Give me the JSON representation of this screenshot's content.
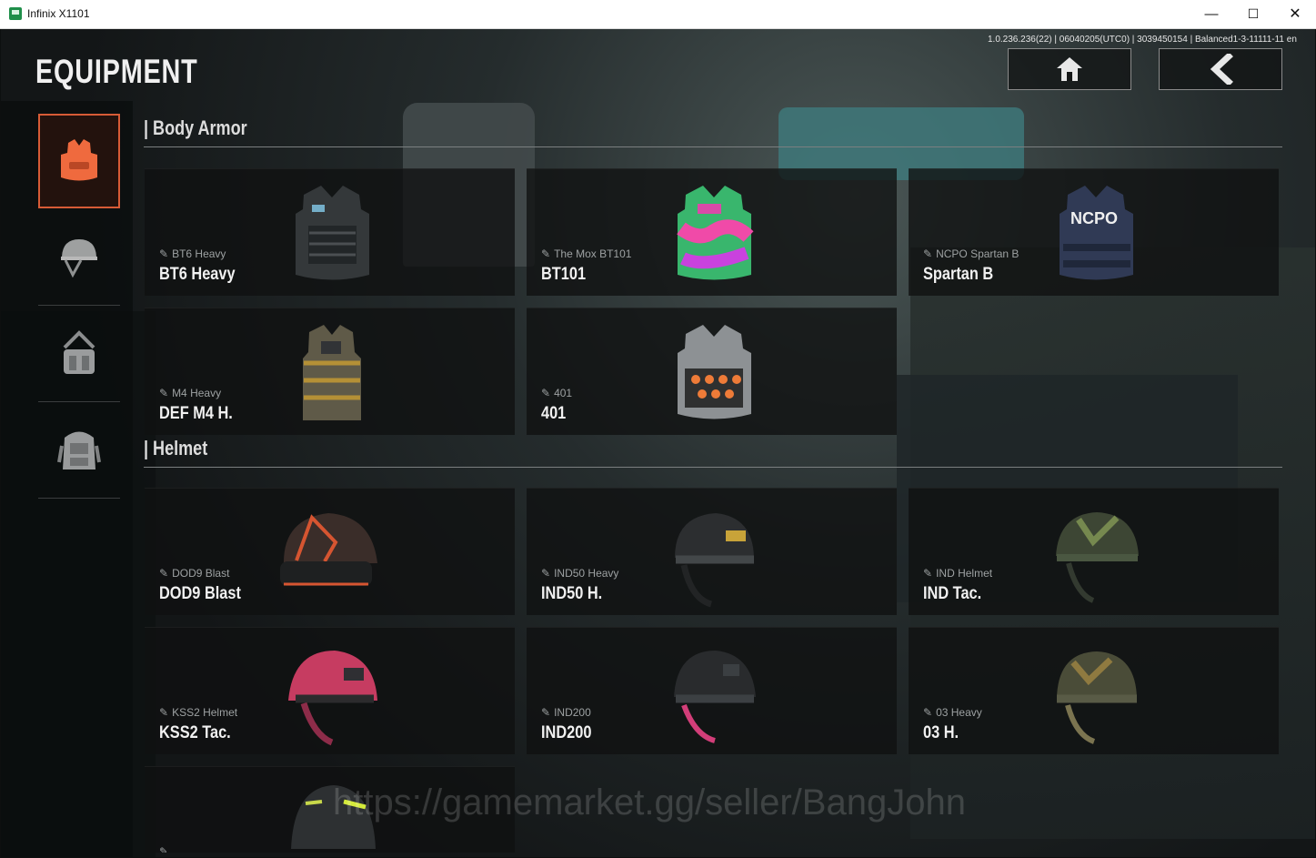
{
  "window": {
    "title": "Infinix X1101",
    "controls": {
      "minimize": "—",
      "maximize": "☐",
      "close": "✕"
    }
  },
  "header": {
    "title": "EQUIPMENT",
    "version": "1.0.236.236(22) | 06040205(UTC0) | 3039450154 | Balanced1-3-11111-11 en"
  },
  "sidebar": {
    "items": [
      {
        "icon": "body-armor-icon"
      },
      {
        "icon": "helmet-icon"
      },
      {
        "icon": "bag-icon"
      },
      {
        "icon": "backpack-icon"
      }
    ]
  },
  "sections": {
    "body_armor": {
      "title": "| Body Armor",
      "items": [
        {
          "small": "BT6 Heavy",
          "name": "BT6 Heavy"
        },
        {
          "small": "The Mox BT101",
          "name": "BT101"
        },
        {
          "small": "NCPO Spartan B",
          "name": "Spartan B"
        },
        {
          "small": "M4 Heavy",
          "name": "DEF M4 H."
        },
        {
          "small": "401",
          "name": "401"
        }
      ]
    },
    "helmet": {
      "title": "| Helmet",
      "items": [
        {
          "small": "DOD9 Blast",
          "name": "DOD9 Blast"
        },
        {
          "small": "IND50 Heavy",
          "name": "IND50 H."
        },
        {
          "small": "IND Helmet",
          "name": "IND Tac."
        },
        {
          "small": "KSS2 Helmet",
          "name": "KSS2 Tac."
        },
        {
          "small": "IND200",
          "name": "IND200"
        },
        {
          "small": "03 Heavy",
          "name": "03 H."
        },
        {
          "small": "",
          "name": ""
        }
      ]
    }
  },
  "watermark": "https://gamemarket.gg/seller/BangJohn"
}
